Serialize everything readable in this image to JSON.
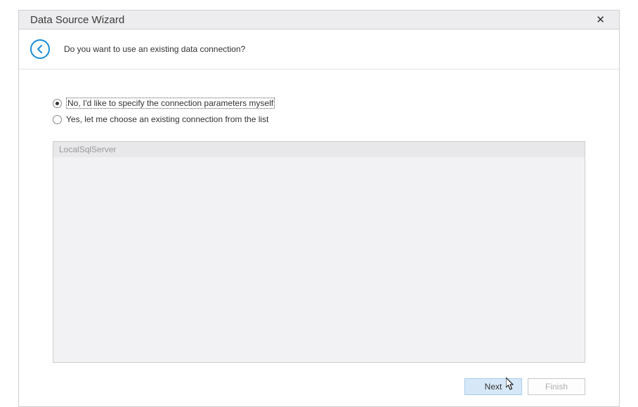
{
  "titlebar": {
    "title": "Data Source Wizard"
  },
  "header": {
    "question": "Do you want to use an existing data connection?"
  },
  "radios": {
    "option_no": "No, I'd like to specify the connection parameters myself",
    "option_yes": "Yes, let me choose an existing connection from the list",
    "selected": "no"
  },
  "list": {
    "items": [
      "LocalSqlServer"
    ]
  },
  "buttons": {
    "next": "Next",
    "finish": "Finish"
  }
}
